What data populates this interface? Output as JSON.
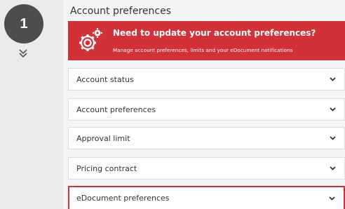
{
  "step": {
    "number": "1"
  },
  "section": {
    "title": "Account preferences"
  },
  "banner": {
    "title": "Need to update your account preferences?",
    "subtitle": "Manage account preferences, limits and your eDocument notifications",
    "color": "#d23237"
  },
  "accordion": {
    "items": [
      {
        "label": "Account status"
      },
      {
        "label": "Account preferences"
      },
      {
        "label": "Approval limit"
      },
      {
        "label": "Pricing contract"
      },
      {
        "label": "eDocument preferences",
        "highlighted": true
      }
    ]
  }
}
